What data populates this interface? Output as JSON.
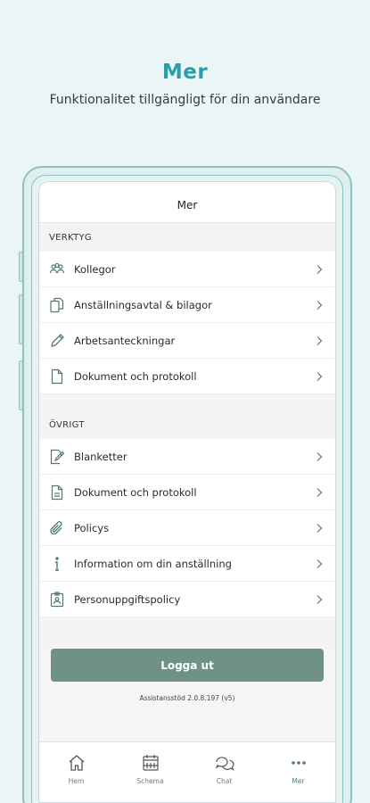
{
  "promo": {
    "title": "Mer",
    "subtitle": "Funktionalitet tillgängligt för din användare"
  },
  "header": {
    "title": "Mer"
  },
  "colors": {
    "accent": "#2a9ea8",
    "button": "#6f9186",
    "icon": "#4f7a70"
  },
  "sections": [
    {
      "title": "VERKTYG",
      "items": [
        {
          "label": "Kollegor",
          "icon": "people-icon"
        },
        {
          "label": "Anställningsavtal & bilagor",
          "icon": "copy-documents-icon"
        },
        {
          "label": "Arbetsanteckningar",
          "icon": "pencil-icon"
        },
        {
          "label": "Dokument och protokoll",
          "icon": "document-icon"
        }
      ]
    },
    {
      "title": "ÖVRIGT",
      "items": [
        {
          "label": "Blanketter",
          "icon": "form-edit-icon"
        },
        {
          "label": "Dokument och protokoll",
          "icon": "document-lines-icon"
        },
        {
          "label": "Policys",
          "icon": "paperclip-icon"
        },
        {
          "label": "Information om din anställning",
          "icon": "info-icon"
        },
        {
          "label": "Personuppgiftspolicy",
          "icon": "badge-icon"
        }
      ]
    }
  ],
  "logout_label": "Logga ut",
  "version": "Assistansstöd 2.0.8.197 (v5)",
  "tabs": [
    {
      "label": "Hem",
      "icon": "home-icon"
    },
    {
      "label": "Schema",
      "icon": "calendar-icon"
    },
    {
      "label": "Chat",
      "icon": "chat-icon"
    },
    {
      "label": "Mer",
      "icon": "more-icon"
    }
  ]
}
